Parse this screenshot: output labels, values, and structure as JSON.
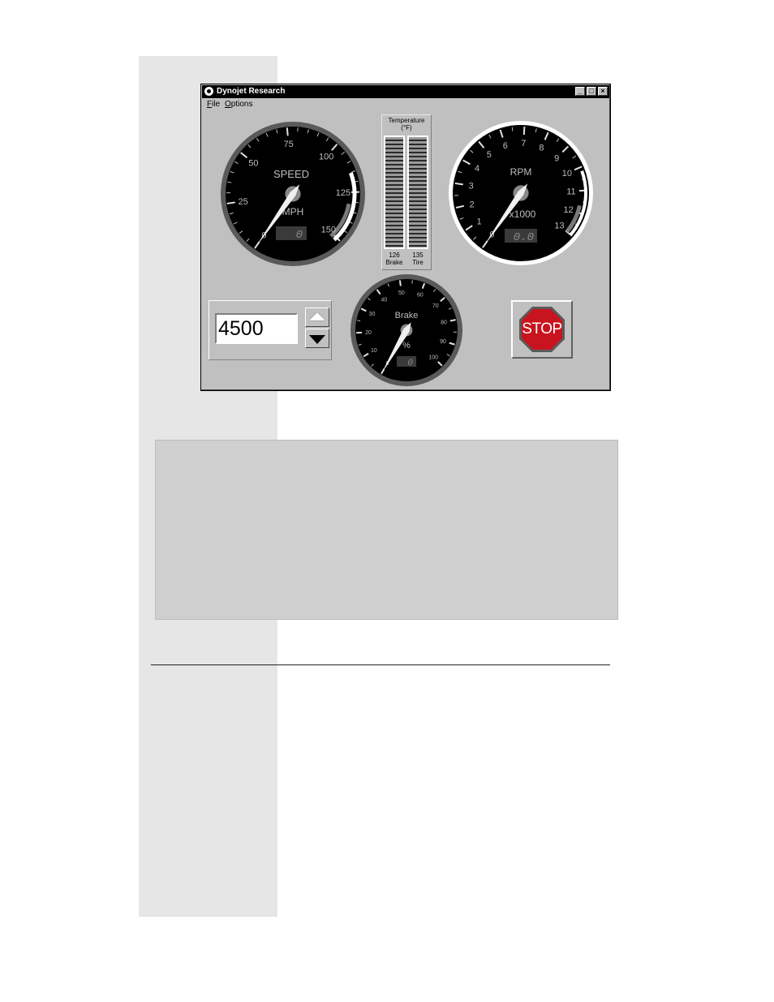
{
  "window": {
    "title": "Dynojet Research",
    "buttons": {
      "minimize": "_",
      "maximize": "□",
      "close": "×"
    }
  },
  "menu": {
    "file": "File",
    "options": "Options"
  },
  "speed_gauge": {
    "label": "SPEED",
    "unit": "MPH",
    "ticks": [
      "0",
      "25",
      "50",
      "75",
      "100",
      "125",
      "150"
    ],
    "readout": "0",
    "value": 0
  },
  "rpm_gauge": {
    "label": "RPM",
    "unit": "x1000",
    "ticks": [
      "0",
      "1",
      "2",
      "3",
      "4",
      "5",
      "6",
      "7",
      "8",
      "9",
      "10",
      "11",
      "12",
      "13"
    ],
    "readout": "0.0",
    "value": 0
  },
  "temperature": {
    "title_line1": "Temperature",
    "title_line2": "(°F)",
    "brake_value": "126",
    "brake_label": "Brake",
    "tire_value": "135",
    "tire_label": "Tire"
  },
  "brake_gauge": {
    "label": "Brake",
    "unit": "%",
    "ticks": [
      "0",
      "10",
      "20",
      "30",
      "40",
      "50",
      "60",
      "70",
      "80",
      "90",
      "100"
    ],
    "readout": "0",
    "value": 0
  },
  "rpm_setpoint": {
    "value": "4500"
  },
  "stop_button": {
    "label": "STOP"
  },
  "colors": {
    "titlebar": "#000000",
    "face": "#c0c0c0",
    "gauge_face": "#000000",
    "stop_red": "#c8141e"
  },
  "icons": {
    "spin_up": "triangle-up-icon",
    "spin_down": "triangle-down-icon",
    "stop": "stop-sign-icon"
  }
}
